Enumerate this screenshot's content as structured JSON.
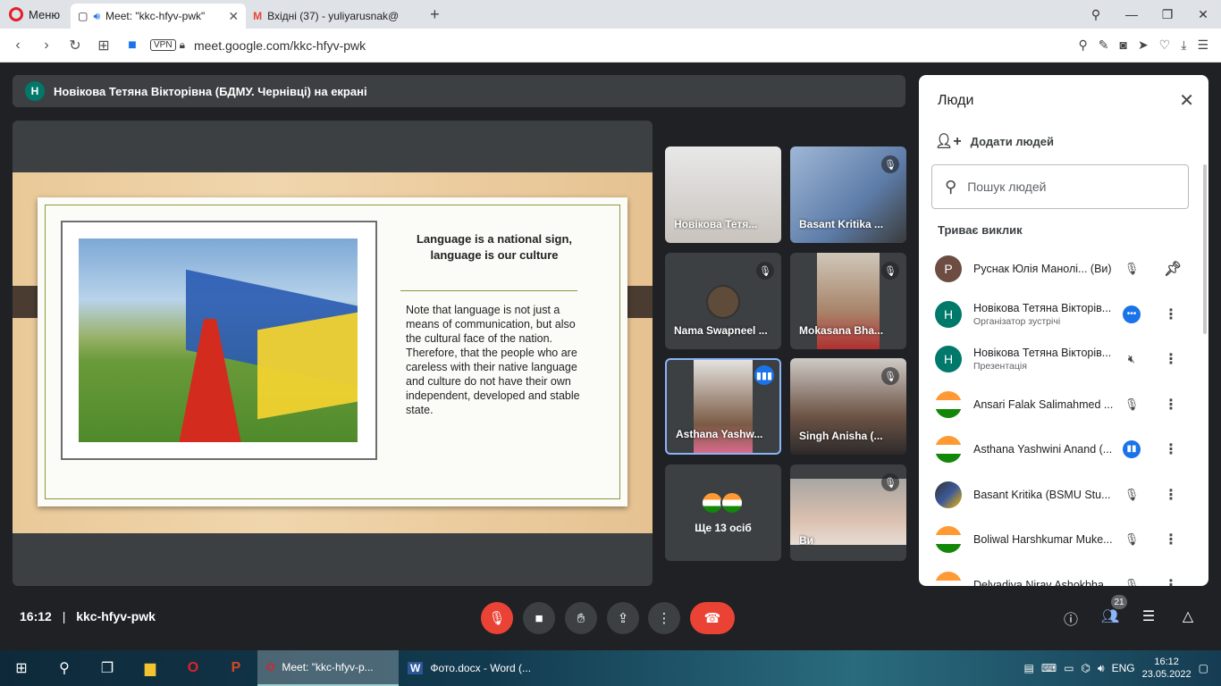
{
  "browser": {
    "menu_label": "Меню",
    "tabs": [
      {
        "title": "Meet: \"kkc-hfyv-pwk\"",
        "active": true
      },
      {
        "title": "Вхідні (37) - yuliyarusnak@",
        "active": false
      }
    ],
    "vpn_label": "VPN",
    "url": "meet.google.com/kkc-hfyv-pwk"
  },
  "meet": {
    "presenter_banner": "Новікова Тетяна Вікторівна (БДМУ. Чернівці) на екрані",
    "presenter_initial": "Н",
    "slide": {
      "title": "Language is a national sign, language is our culture",
      "body": "Note that language is not just a means of communication, but also the cultural face of the nation. Therefore, that the people who are careless with their native language and culture do not have their own independent, developed and stable state."
    },
    "tiles": [
      {
        "name": "Новікова Тетя...",
        "muted": false
      },
      {
        "name": "Basant Kritika ...",
        "muted": true
      },
      {
        "name": "Nama Swapneel ...",
        "muted": true
      },
      {
        "name": "Mokasana Bha...",
        "muted": true
      },
      {
        "name": "Asthana Yashw...",
        "speaking": true
      },
      {
        "name": "Singh Anisha (...",
        "muted": true
      },
      {
        "name": "Ще 13 осіб"
      },
      {
        "name": "Ви",
        "muted": true
      }
    ],
    "meeting_time": "16:12",
    "separator": "|",
    "meeting_code": "kkc-hfyv-pwk",
    "participants_count": "21"
  },
  "people_panel": {
    "title": "Люди",
    "add_people": "Додати людей",
    "search_placeholder": "Пошук людей",
    "section": "Триває виклик",
    "people": [
      {
        "initial": "Р",
        "name": "Руснак Юлія Манолі... (Ви)",
        "role": "",
        "color": "#6d4c41",
        "status": "muted"
      },
      {
        "initial": "Н",
        "name": "Новікова Тетяна Вікторів...",
        "role": "Організатор зустрічі",
        "color": "#00796b",
        "status": "more"
      },
      {
        "initial": "Н",
        "name": "Новікова Тетяна Вікторів...",
        "role": "Презентація",
        "color": "#00796b",
        "status": "presenting"
      },
      {
        "initial": "",
        "name": "Ansari Falak Salimahmed ...",
        "role": "",
        "color": "#f4b400",
        "status": "muted"
      },
      {
        "initial": "",
        "name": "Asthana Yashwini Anand (...",
        "role": "",
        "color": "#f4b400",
        "status": "speaking"
      },
      {
        "initial": "",
        "name": "Basant Kritika (BSMU Stu...",
        "role": "",
        "color": "#3b5998",
        "status": "muted"
      },
      {
        "initial": "",
        "name": "Boliwal Harshkumar Muke...",
        "role": "",
        "color": "#f4b400",
        "status": "muted"
      },
      {
        "initial": "",
        "name": "Delvadiya Nirav Ashokbha...",
        "role": "",
        "color": "#f4b400",
        "status": "muted"
      }
    ]
  },
  "taskbar": {
    "apps": [
      {
        "label": "Meet: \"kkc-hfyv-p...",
        "active": true
      },
      {
        "label": "Фото.docx - Word (...",
        "active": false
      }
    ],
    "language": "ENG",
    "time": "16:12",
    "date": "23.05.2022"
  }
}
